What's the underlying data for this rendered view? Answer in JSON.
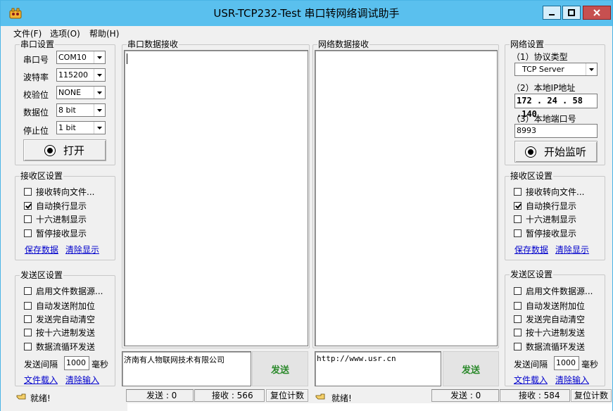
{
  "window": {
    "title": "USR-TCP232-Test 串口转网络调试助手",
    "controls": {
      "minimize": "—",
      "maximize": "□",
      "close": "✕"
    }
  },
  "menu": [
    "文件(F)",
    "选项(O)",
    "帮助(H)"
  ],
  "serial_settings": {
    "title": "串口设置",
    "fields": [
      {
        "label": "串口号",
        "value": "COM10"
      },
      {
        "label": "波特率",
        "value": "115200"
      },
      {
        "label": "校验位",
        "value": "NONE"
      },
      {
        "label": "数据位",
        "value": "8 bit"
      },
      {
        "label": "停止位",
        "value": "1 bit"
      }
    ],
    "open_button": "打开"
  },
  "left_receive_settings": {
    "title": "接收区设置",
    "options": [
      {
        "label": "接收转向文件...",
        "checked": false
      },
      {
        "label": "自动换行显示",
        "checked": true
      },
      {
        "label": "十六进制显示",
        "checked": false
      },
      {
        "label": "暂停接收显示",
        "checked": false
      }
    ],
    "save_link": "保存数据",
    "clear_link": "清除显示"
  },
  "left_send_settings": {
    "title": "发送区设置",
    "options": [
      {
        "label": "启用文件数据源...",
        "checked": false
      },
      {
        "label": "自动发送附加位",
        "checked": false
      },
      {
        "label": "发送完自动清空",
        "checked": false
      },
      {
        "label": "按十六进制发送",
        "checked": false
      },
      {
        "label": "数据流循环发送",
        "checked": false
      }
    ],
    "interval_label": "发送间隔",
    "interval_value": "1000",
    "interval_unit": "毫秒",
    "load_link": "文件载入",
    "clear_link": "清除输入"
  },
  "serial_receive": {
    "title": "串口数据接收"
  },
  "network_receive": {
    "title": "网络数据接收"
  },
  "serial_send": {
    "text": "济南有人物联网技术有限公司",
    "button": "发送"
  },
  "network_send": {
    "text": "http://www.usr.cn",
    "button": "发送"
  },
  "network_settings": {
    "title": "网络设置",
    "protocol_label": "（1）协议类型",
    "protocol_value": "TCP Server",
    "ip_label": "（2）本地IP地址",
    "ip_value": "172 . 24 . 58 .140",
    "port_label": "（3）本地端口号",
    "port_value": "8993",
    "listen_button": "开始监听"
  },
  "right_receive_settings": {
    "title": "接收区设置",
    "options": [
      {
        "label": "接收转向文件...",
        "checked": false
      },
      {
        "label": "自动换行显示",
        "checked": true
      },
      {
        "label": "十六进制显示",
        "checked": false
      },
      {
        "label": "暂停接收显示",
        "checked": false
      }
    ],
    "save_link": "保存数据",
    "clear_link": "清除显示"
  },
  "right_send_settings": {
    "title": "发送区设置",
    "options": [
      {
        "label": "启用文件数据源...",
        "checked": false
      },
      {
        "label": "自动发送附加位",
        "checked": false
      },
      {
        "label": "发送完自动清空",
        "checked": false
      },
      {
        "label": "按十六进制发送",
        "checked": false
      },
      {
        "label": "数据流循环发送",
        "checked": false
      }
    ],
    "interval_label": "发送间隔",
    "interval_value": "1000",
    "interval_unit": "毫秒",
    "load_link": "文件载入",
    "clear_link": "清除输入"
  },
  "status": {
    "left": {
      "state": "就绪!",
      "sent": "发送 : 0",
      "received": "接收 : 566",
      "reset": "复位计数"
    },
    "right": {
      "state": "就绪!",
      "sent": "发送 : 0",
      "received": "接收 : 584",
      "reset": "复位计数"
    }
  },
  "colors": {
    "titlebar": "#5ac0ee",
    "send_button_text": "#2c8a2c",
    "link": "#0000cc",
    "close_button": "#c75050"
  },
  "icons": {
    "app": "app-icon",
    "status": "pointing-hand-icon"
  }
}
